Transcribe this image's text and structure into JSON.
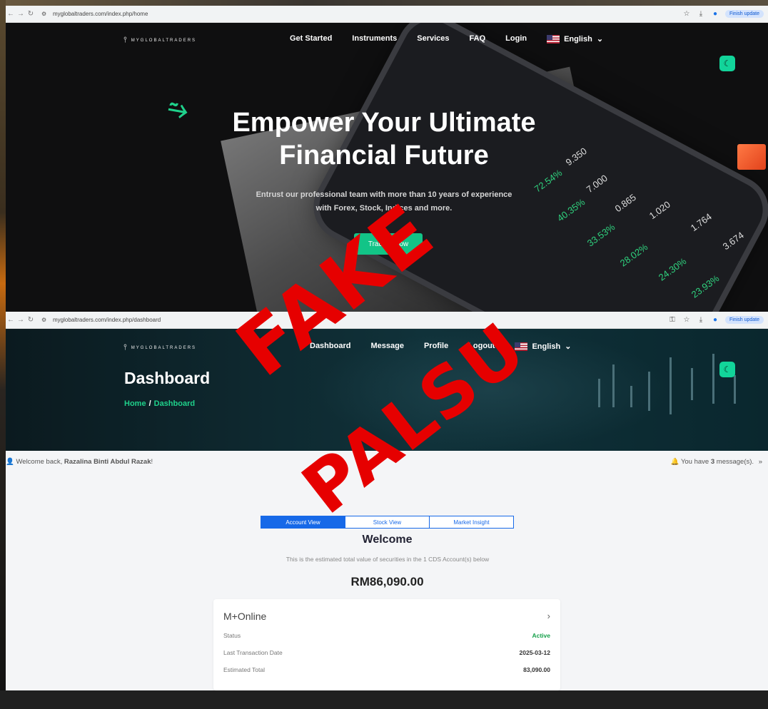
{
  "top_browser": {
    "url": "myglobaltraders.com/index.php/home",
    "update_label": "Finish update"
  },
  "bottom_browser": {
    "url": "myglobaltraders.com/index.php/dashboard",
    "update_label": "Finish update"
  },
  "logo_text": "MYGLOBALTRADERS",
  "home": {
    "nav": [
      "Get Started",
      "Instruments",
      "Services",
      "FAQ",
      "Login"
    ],
    "language": "English",
    "hero_title_line1": "Empower Your Ultimate",
    "hero_title_line2": "Financial Future",
    "hero_sub_line1": "Entrust our professional team with more than 10 years of experience",
    "hero_sub_line2": "with Forex, Stock, Indices and more.",
    "cta": "Trading Now",
    "phone_numbers": [
      "9.350",
      "7.000",
      "0.865",
      "1.020",
      "1.764",
      "3.674"
    ],
    "phone_percents": [
      "72.54%",
      "40.35%",
      "33.53%",
      "28.02%",
      "24.30%",
      "23.93%"
    ]
  },
  "dashboard": {
    "nav": [
      "Dashboard",
      "Message",
      "Profile",
      "Logout"
    ],
    "language": "English",
    "title": "Dashboard",
    "breadcrumb_home": "Home",
    "breadcrumb_sep": "/",
    "breadcrumb_current": "Dashboard",
    "welcome_prefix": "Welcome back,",
    "user_name": "Razalina Binti Abdul Razak",
    "welcome_suffix": "!",
    "messages_prefix": "You have",
    "messages_count": "3",
    "messages_suffix": "message(s).",
    "tabs": [
      "Account View",
      "Stock View",
      "Market Insight"
    ],
    "welcome_title": "Welcome",
    "welcome_sub": "This is the estimated total value of securities in the 1 CDS Account(s) below",
    "total": "RM86,090.00",
    "card": {
      "name": "M+Online",
      "rows": [
        {
          "label": "Status",
          "value": "Active"
        },
        {
          "label": "Last Transaction Date",
          "value": "2025-03-12"
        },
        {
          "label": "Estimated Total",
          "value": "83,090.00"
        }
      ]
    }
  },
  "watermark": {
    "word1": "FAKE",
    "word2": "PALSU",
    "color": "#e60000"
  },
  "colors": {
    "accent_green": "#12c487",
    "tab_blue": "#1769e8",
    "status_green": "#16a04a"
  }
}
